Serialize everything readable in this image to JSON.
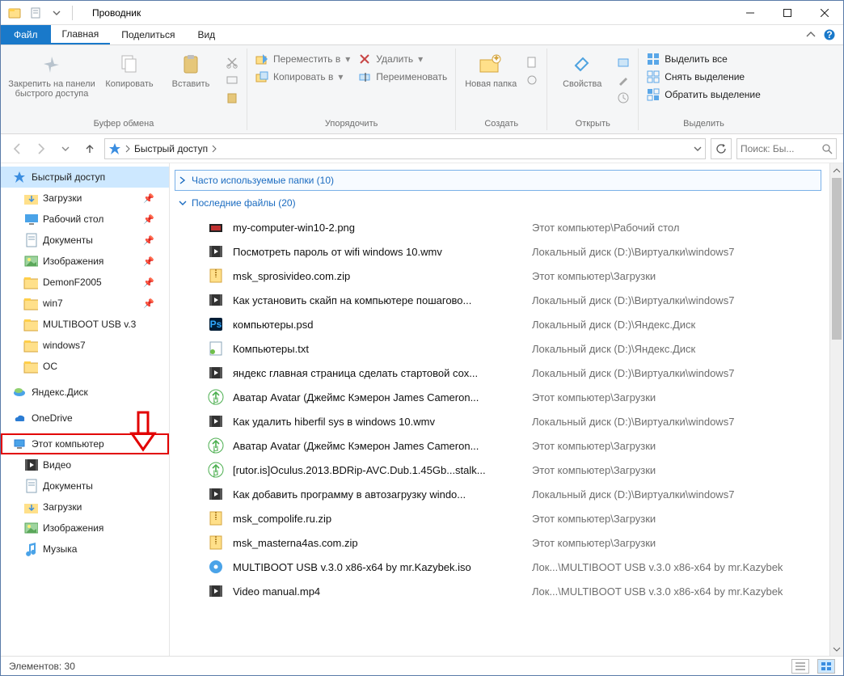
{
  "window": {
    "title": "Проводник"
  },
  "tabs": {
    "file": "Файл",
    "home": "Главная",
    "share": "Поделиться",
    "view": "Вид"
  },
  "ribbon": {
    "clipboard": {
      "label": "Буфер обмена",
      "pin": "Закрепить на панели быстрого доступа",
      "copy": "Копировать",
      "paste": "Вставить"
    },
    "organize": {
      "label": "Упорядочить",
      "move_to": "Переместить в",
      "copy_to": "Копировать в",
      "delete": "Удалить",
      "rename": "Переименовать"
    },
    "create": {
      "label": "Создать",
      "new_folder": "Новая папка"
    },
    "open": {
      "label": "Открыть",
      "properties": "Свойства"
    },
    "select": {
      "label": "Выделить",
      "select_all": "Выделить все",
      "select_none": "Снять выделение",
      "invert": "Обратить выделение"
    }
  },
  "address": {
    "crumb": "Быстрый доступ"
  },
  "search": {
    "placeholder": "Поиск: Бы..."
  },
  "sidebar": {
    "quick_access": "Быстрый доступ",
    "items": [
      {
        "label": "Загрузки",
        "pin": true,
        "icon": "downloads"
      },
      {
        "label": "Рабочий стол",
        "pin": true,
        "icon": "desktop"
      },
      {
        "label": "Документы",
        "pin": true,
        "icon": "documents"
      },
      {
        "label": "Изображения",
        "pin": true,
        "icon": "pictures"
      },
      {
        "label": "DemonF2005",
        "pin": true,
        "icon": "folder"
      },
      {
        "label": "win7",
        "pin": true,
        "icon": "folder"
      },
      {
        "label": "MULTIBOOT USB v.3",
        "pin": false,
        "icon": "folder"
      },
      {
        "label": "windows7",
        "pin": false,
        "icon": "folder"
      },
      {
        "label": "ОС",
        "pin": false,
        "icon": "folder"
      }
    ],
    "yandex": "Яндекс.Диск",
    "onedrive": "OneDrive",
    "this_pc": "Этот компьютер",
    "pc_items": [
      {
        "label": "Видео",
        "icon": "video"
      },
      {
        "label": "Документы",
        "icon": "documents"
      },
      {
        "label": "Загрузки",
        "icon": "downloads"
      },
      {
        "label": "Изображения",
        "icon": "pictures"
      },
      {
        "label": "Музыка",
        "icon": "music"
      }
    ]
  },
  "groups": {
    "frequent": "Часто используемые папки (10)",
    "recent": "Последние файлы (20)"
  },
  "files": [
    {
      "name": "my-computer-win10-2.png",
      "path": "Этот компьютер\\Рабочий стол",
      "icon": "png"
    },
    {
      "name": "Посмотреть пароль от wifi windows 10.wmv",
      "path": "Локальный диск (D:)\\Виртуалки\\windows7",
      "icon": "video"
    },
    {
      "name": "msk_sprosivideo.com.zip",
      "path": "Этот компьютер\\Загрузки",
      "icon": "zip"
    },
    {
      "name": "Как установить скайп на компьютере пошагово...",
      "path": "Локальный диск (D:)\\Виртуалки\\windows7",
      "icon": "video"
    },
    {
      "name": "компьютеры.psd",
      "path": "Локальный диск (D:)\\Яндекс.Диск",
      "icon": "psd"
    },
    {
      "name": "Компьютеры.txt",
      "path": "Локальный диск (D:)\\Яндекс.Диск",
      "icon": "txt"
    },
    {
      "name": "яндекс главная страница сделать стартовой сох...",
      "path": "Локальный диск (D:)\\Виртуалки\\windows7",
      "icon": "video"
    },
    {
      "name": "Аватар Avatar (Джеймс Кэмерон James Cameron...",
      "path": "Этот компьютер\\Загрузки",
      "icon": "torrent"
    },
    {
      "name": "Как удалить hiberfil sys в windows 10.wmv",
      "path": "Локальный диск (D:)\\Виртуалки\\windows7",
      "icon": "video"
    },
    {
      "name": "Аватар Avatar (Джеймс Кэмерон James Cameron...",
      "path": "Этот компьютер\\Загрузки",
      "icon": "torrent"
    },
    {
      "name": "[rutor.is]Oculus.2013.BDRip-AVC.Dub.1.45Gb...stalk...",
      "path": "Этот компьютер\\Загрузки",
      "icon": "torrent"
    },
    {
      "name": "Как добавить программу в автозагрузку windo...",
      "path": "Локальный диск (D:)\\Виртуалки\\windows7",
      "icon": "video"
    },
    {
      "name": "msk_compolife.ru.zip",
      "path": "Этот компьютер\\Загрузки",
      "icon": "zip"
    },
    {
      "name": "msk_masterna4as.com.zip",
      "path": "Этот компьютер\\Загрузки",
      "icon": "zip"
    },
    {
      "name": "MULTIBOOT USB v.3.0 x86-x64 by mr.Kazybek.iso",
      "path": "Лок...\\MULTIBOOT USB v.3.0 x86-x64 by mr.Kazybek",
      "icon": "iso"
    },
    {
      "name": "Video manual.mp4",
      "path": "Лок...\\MULTIBOOT USB v.3.0 x86-x64 by mr.Kazybek",
      "icon": "video"
    }
  ],
  "status": {
    "elements": "Элементов: 30"
  }
}
